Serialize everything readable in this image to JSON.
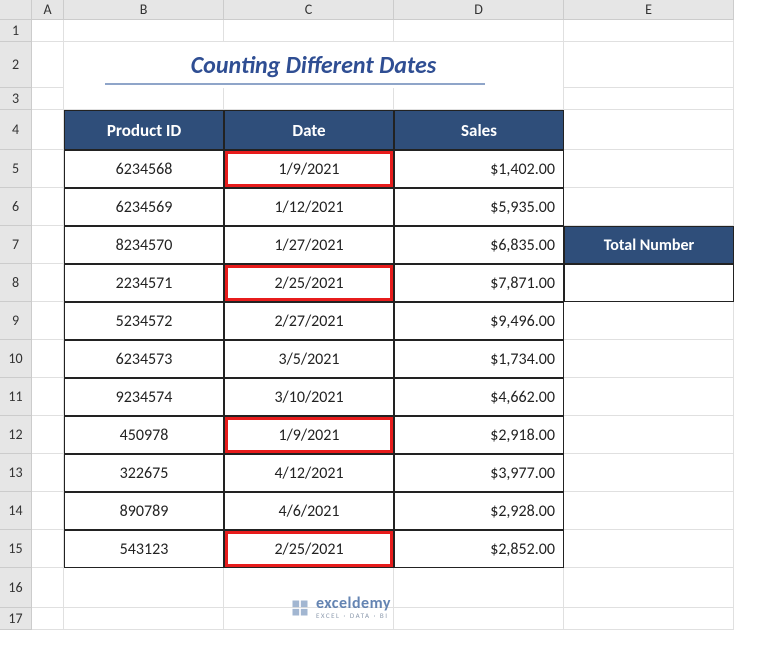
{
  "columns": {
    "A": "A",
    "B": "B",
    "C": "C",
    "D": "D",
    "E": "E"
  },
  "row_nums": {
    "r1": "1",
    "r2": "2",
    "r3": "3",
    "r4": "4",
    "r5": "5",
    "r6": "6",
    "r7": "7",
    "r8": "8",
    "r9": "9",
    "r10": "10",
    "r11": "11",
    "r12": "12",
    "r13": "13",
    "r14": "14",
    "r15": "15",
    "r16": "16",
    "r17": "17"
  },
  "title": "Counting Different Dates",
  "headers": {
    "product_id": "Product ID",
    "date": "Date",
    "sales": "Sales"
  },
  "side": {
    "total_label": "Total Number",
    "total_value": ""
  },
  "rows": [
    {
      "product_id": "6234568",
      "date": "1/9/2021",
      "sales": "$1,402.00",
      "hl": true
    },
    {
      "product_id": "6234569",
      "date": "1/12/2021",
      "sales": "$5,935.00",
      "hl": false
    },
    {
      "product_id": "8234570",
      "date": "1/27/2021",
      "sales": "$6,835.00",
      "hl": false
    },
    {
      "product_id": "2234571",
      "date": "2/25/2021",
      "sales": "$7,871.00",
      "hl": true
    },
    {
      "product_id": "5234572",
      "date": "2/27/2021",
      "sales": "$9,496.00",
      "hl": false
    },
    {
      "product_id": "6234573",
      "date": "3/5/2021",
      "sales": "$1,734.00",
      "hl": false
    },
    {
      "product_id": "9234574",
      "date": "3/10/2021",
      "sales": "$4,662.00",
      "hl": false
    },
    {
      "product_id": "450978",
      "date": "1/9/2021",
      "sales": "$2,918.00",
      "hl": true
    },
    {
      "product_id": "322675",
      "date": "4/12/2021",
      "sales": "$3,977.00",
      "hl": false
    },
    {
      "product_id": "890789",
      "date": "4/6/2021",
      "sales": "$2,928.00",
      "hl": false
    },
    {
      "product_id": "543123",
      "date": "2/25/2021",
      "sales": "$2,852.00",
      "hl": true
    }
  ],
  "watermark": {
    "main": "exceldemy",
    "sub": "EXCEL · DATA · BI"
  }
}
